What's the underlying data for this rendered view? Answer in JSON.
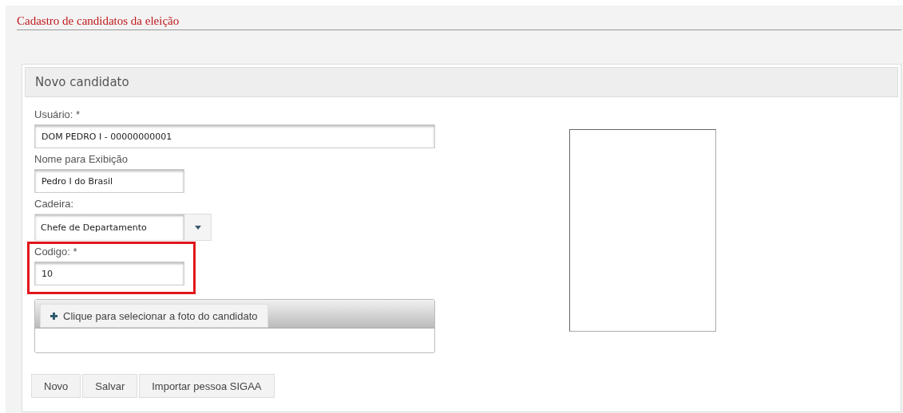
{
  "page_title": "Cadastro de candidatos da eleição",
  "panel": {
    "title": "Novo candidato"
  },
  "fields": [
    {
      "kind": "widetext",
      "label": "Usuário: *",
      "value": "DOM PEDRO I - 00000000001",
      "highlighted": false
    },
    {
      "kind": "text",
      "label": "Nome para Exibição",
      "value": "Pedro I do Brasil",
      "highlighted": false
    },
    {
      "kind": "select",
      "label": "Cadeira:",
      "value": "Chefe de Departamento",
      "highlighted": false
    },
    {
      "kind": "text",
      "label": "Codigo: *",
      "value": "10",
      "highlighted": true
    }
  ],
  "upload": {
    "label": "Clique para selecionar a foto do candidato"
  },
  "buttons": [
    "Novo",
    "Salvar",
    "Importar pessoa SIGAA"
  ]
}
